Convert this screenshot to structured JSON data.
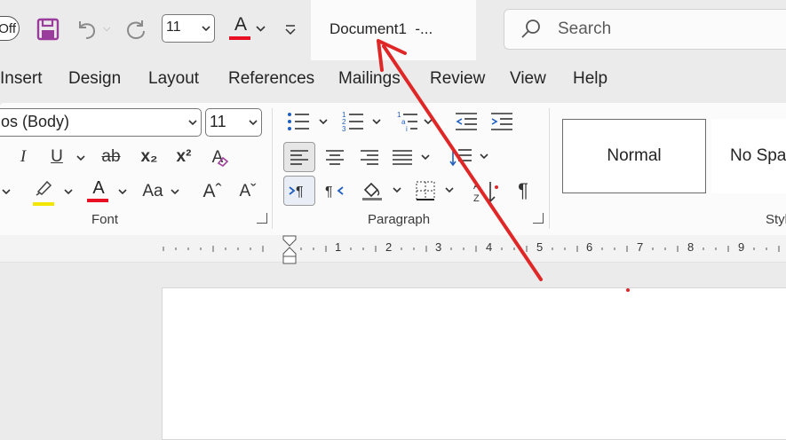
{
  "titlebar": {
    "autosave_toggle": "Off",
    "font_size": "11",
    "font_color_icon": "A",
    "document_title": "Document1  -...",
    "search_placeholder": "Search"
  },
  "tabs": [
    "Insert",
    "Design",
    "Layout",
    "References",
    "Mailings",
    "Review",
    "View",
    "Help"
  ],
  "font_group": {
    "font_name": "os (Body)",
    "font_size": "11",
    "italic": "I",
    "underline": "U",
    "strikethrough": "ab",
    "subscript": "x₂",
    "superscript": "x²",
    "clear_formatting": "A",
    "font_color": "A",
    "change_case": "Aa",
    "grow_font": "Aˆ",
    "shrink_font": "Aˇ",
    "label": "Font"
  },
  "paragraph_group": {
    "label": "Paragraph",
    "pilcrow": "¶"
  },
  "styles_group": {
    "normal": "Normal",
    "no_spacing": "No Spa",
    "label": "Styl"
  },
  "ruler": {
    "numbers": [
      "1",
      "2",
      "3",
      "4",
      "5",
      "6",
      "7",
      "8",
      "9"
    ]
  },
  "colors": {
    "accent_red": "#e81123",
    "highlight_yellow": "#f2e600",
    "save_purple": "#9a3c9c",
    "annotation_arrow": "#e02727"
  }
}
